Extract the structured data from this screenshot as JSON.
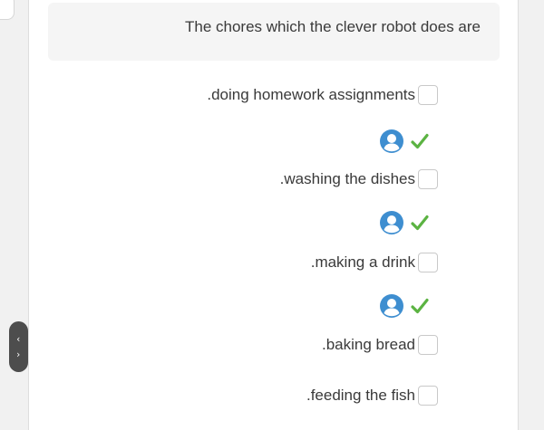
{
  "question": {
    "text": "The chores which the clever robot does are"
  },
  "options": [
    {
      "label": ".doing homework assignments",
      "checked": false
    },
    {
      "label": ".washing the dishes",
      "checked": false
    },
    {
      "label": ".making a drink",
      "checked": false
    },
    {
      "label": ".baking bread",
      "checked": false
    },
    {
      "label": ".feeding the fish",
      "checked": false
    }
  ],
  "feedback_icons": [
    "user-icon",
    "checkmark-icon"
  ],
  "nav": {
    "prev_icon": "chevron-left-icon",
    "next_icon": "chevron-right-icon",
    "prev_glyph": "‹",
    "next_glyph": "›"
  },
  "colors": {
    "accent_blue": "#3e8ed0",
    "check_green": "#5bb342",
    "card_bg": "#ffffff",
    "page_bg": "#f1f1f1",
    "question_bg": "#f5f5f5",
    "text": "#3a3a3a"
  }
}
